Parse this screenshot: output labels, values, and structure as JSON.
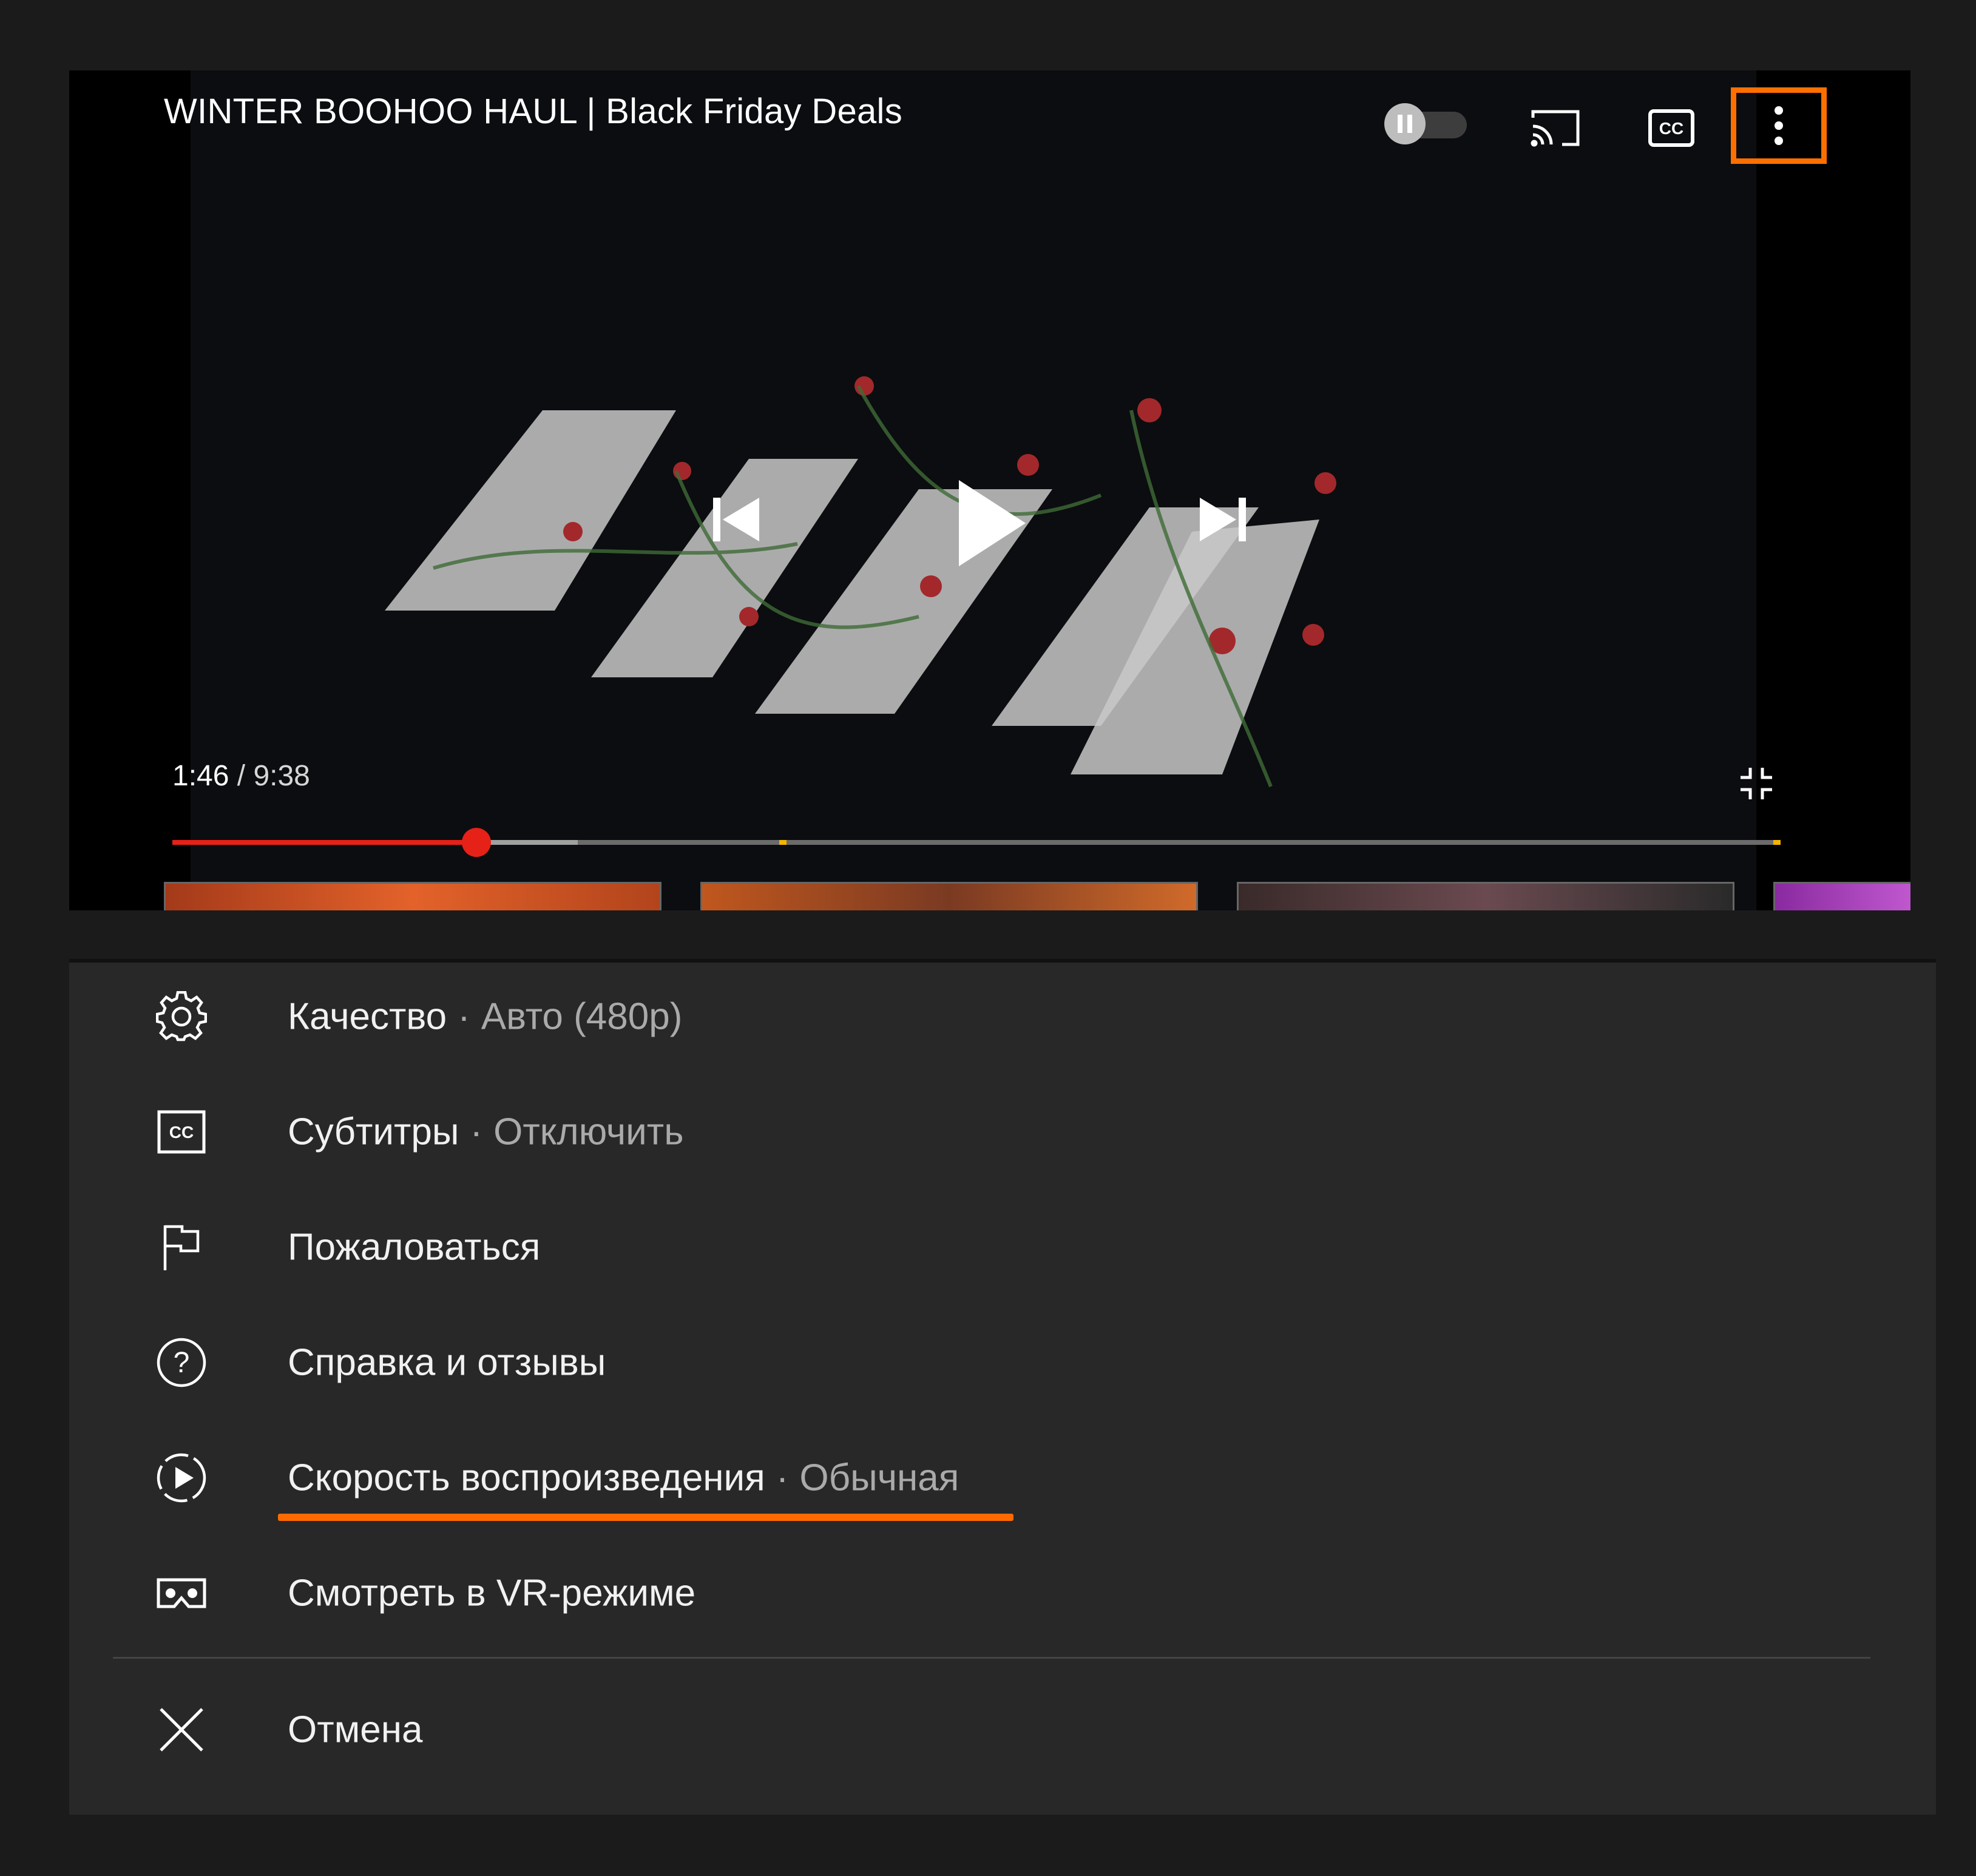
{
  "player": {
    "title": "WINTER BOOHOO HAUL | Black Friday Deals",
    "current_time": "1:46",
    "separator": "/",
    "duration": "9:38",
    "played_fraction": 0.189,
    "buffered_fraction": 0.252,
    "autoplay_on": false
  },
  "menu": {
    "items": [
      {
        "label": "Качество",
        "value": "Авто (480p)",
        "icon": "gear-icon"
      },
      {
        "label": "Субтитры",
        "value": "Отключить",
        "icon": "cc-icon"
      },
      {
        "label": "Пожаловаться",
        "value": "",
        "icon": "flag-icon"
      },
      {
        "label": "Справка и отзывы",
        "value": "",
        "icon": "help-icon"
      },
      {
        "label": "Скорость воспроизведения",
        "value": "Обычная",
        "icon": "playback-speed-icon"
      },
      {
        "label": "Смотреть в VR-режиме",
        "value": "",
        "icon": "vr-icon"
      }
    ],
    "dot": "·",
    "cancel_label": "Отмена"
  },
  "colors": {
    "highlight": "#ff6f00",
    "progress_played": "#e62117",
    "menu_bg": "#282828",
    "page_bg": "#1b1b1b"
  }
}
